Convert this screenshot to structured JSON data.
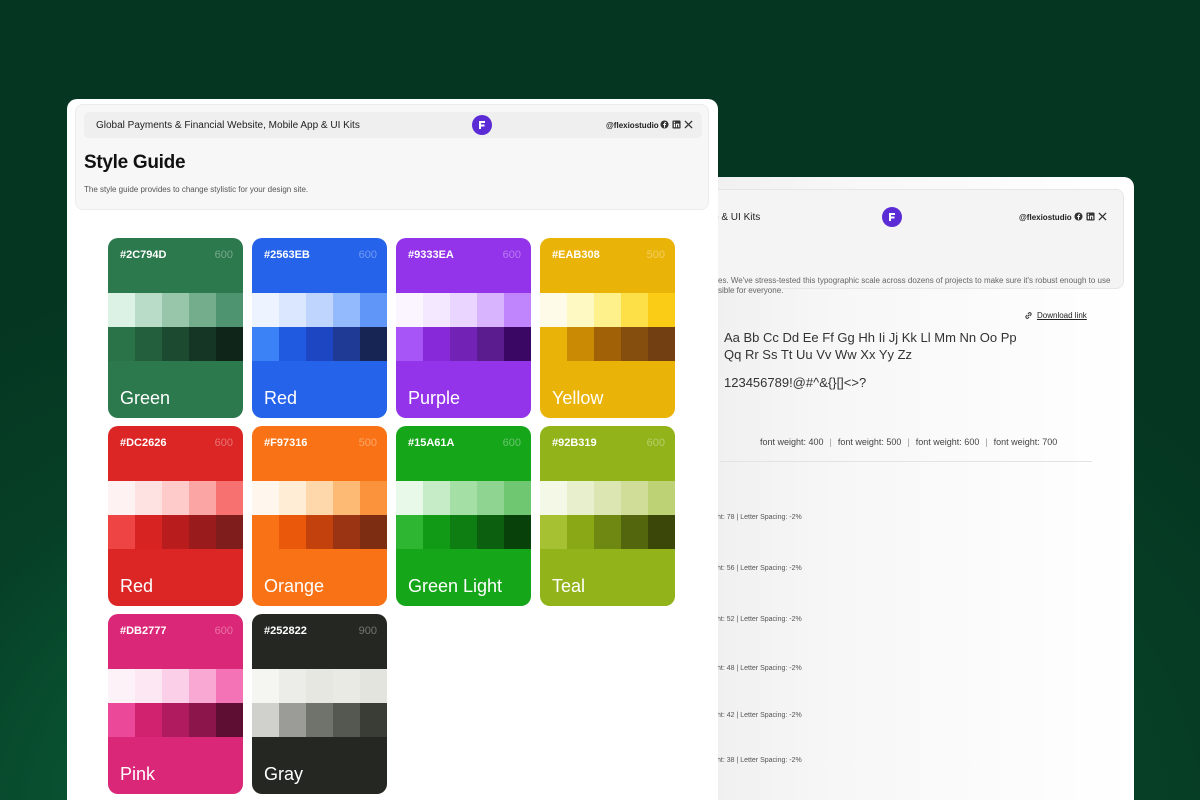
{
  "back": {
    "title": "p & UI Kits",
    "handle": "@flexiostudio",
    "description": "es. We've stress-tested this typographic scale across dozens of projects to make sure it's robust enough to use sible for everyone.",
    "download_label": "Download link",
    "alphabet": "Aa Bb Cc Dd Ee Ff Gg Hh Ii Jj Kk Ll Mm Nn Oo Pp Qq Rr Ss Tt Uu Vv Ww Xx Yy Zz",
    "digits": "123456789!@#^&{}[]<>?",
    "weights": [
      "font weight: 400",
      "font weight: 500",
      "font weight: 600",
      "font weight: 700"
    ],
    "specs": [
      "ht: 78 | Letter Spacing: -2%",
      "ht: 56 | Letter Spacing: -2%",
      "ht: 52 | Letter Spacing: -2%",
      "ht: 48 | Letter Spacing: -2%",
      "ht: 42 | Letter Spacing: -2%",
      "ht: 38 | Letter Spacing: -2%"
    ]
  },
  "front": {
    "header_title": "Global Payments & Financial Website, Mobile App & UI Kits",
    "handle": "@flexiostudio",
    "page_title": "Style Guide",
    "page_subtitle": "The style guide provides to change stylistic for your design site."
  },
  "icons": {
    "logo": "flexio-logo-icon",
    "facebook": "facebook-icon",
    "linkedin": "linkedin-icon",
    "x": "x-icon",
    "link": "link-icon"
  },
  "palette": [
    {
      "hex": "#2C794D",
      "weight": "600",
      "name": "Green",
      "base": "#2C794D",
      "light": [
        "#dcf2e4",
        "#b9dcc8",
        "#98c6ab",
        "#74ad8c",
        "#4f9470"
      ],
      "dark": [
        "#2a7349",
        "#235f3d",
        "#1c4a30",
        "#153624",
        "#0f2519"
      ]
    },
    {
      "hex": "#2563EB",
      "weight": "600",
      "name": "Red",
      "base": "#2563EB",
      "light": [
        "#eef4ff",
        "#dbe7fe",
        "#c0d5fd",
        "#93bafc",
        "#5f96f8"
      ],
      "dark": [
        "#3b82f6",
        "#1f5ae0",
        "#1d46c2",
        "#1e3a94",
        "#172554"
      ]
    },
    {
      "hex": "#9333EA",
      "weight": "600",
      "name": "Purple",
      "base": "#9333EA",
      "light": [
        "#faf5ff",
        "#f3e8ff",
        "#e9d5ff",
        "#d8b4fe",
        "#c084fc"
      ],
      "dark": [
        "#a855f7",
        "#8729d9",
        "#7322b6",
        "#5b1c90",
        "#3b0764"
      ]
    },
    {
      "hex": "#EAB308",
      "weight": "500",
      "name": "Yellow",
      "base": "#EAB308",
      "light": [
        "#fefce8",
        "#fef9c3",
        "#fef08a",
        "#fde047",
        "#facc15"
      ],
      "dark": [
        "#eab308",
        "#ca8a04",
        "#a16207",
        "#854d0e",
        "#713f12"
      ]
    },
    {
      "hex": "#DC2626",
      "weight": "600",
      "name": "Red",
      "base": "#DC2626",
      "light": [
        "#fef2f2",
        "#fee2e2",
        "#fecaca",
        "#fca5a5",
        "#f87171"
      ],
      "dark": [
        "#ef4444",
        "#d82323",
        "#b91c1c",
        "#991b1b",
        "#7f1d1d"
      ]
    },
    {
      "hex": "#F97316",
      "weight": "500",
      "name": "Orange",
      "base": "#F97316",
      "light": [
        "#fff7ed",
        "#ffedd5",
        "#fed7aa",
        "#fdba74",
        "#fb923c"
      ],
      "dark": [
        "#f97316",
        "#ea580c",
        "#c2410c",
        "#9a3412",
        "#7c2d12"
      ]
    },
    {
      "hex": "#15A61A",
      "weight": "600",
      "name": "Green Light",
      "base": "#15A61A",
      "light": [
        "#e8f9e9",
        "#c5ecc7",
        "#a4dfa6",
        "#8fd591",
        "#6fc772"
      ],
      "dark": [
        "#2eb532",
        "#119a16",
        "#0e7d12",
        "#0b5f0e",
        "#08420a"
      ]
    },
    {
      "hex": "#92B319",
      "weight": "600",
      "name": "Teal",
      "base": "#92B319",
      "light": [
        "#f4f8e6",
        "#e7efcc",
        "#dbe6b3",
        "#cfdd99",
        "#bcd274"
      ],
      "dark": [
        "#a6c233",
        "#8aa716",
        "#6f8812",
        "#53660d",
        "#3a4709"
      ]
    },
    {
      "hex": "#DB2777",
      "weight": "600",
      "name": "Pink",
      "base": "#DB2777",
      "light": [
        "#fdf2f8",
        "#fce7f3",
        "#fbcfe8",
        "#f9a8d4",
        "#f472b6"
      ],
      "dark": [
        "#ec4899",
        "#d0226f",
        "#b01a5e",
        "#8c154c",
        "#5e0e33"
      ]
    },
    {
      "hex": "#252822",
      "weight": "900",
      "name": "Gray",
      "base": "#252822",
      "light": [
        "#f5f6f2",
        "#ecede8",
        "#e6e7e1",
        "#e9eae4",
        "#e3e4de"
      ],
      "dark": [
        "#d0d1cd",
        "#9b9c98",
        "#70726c",
        "#555751",
        "#3a3d36"
      ]
    }
  ]
}
